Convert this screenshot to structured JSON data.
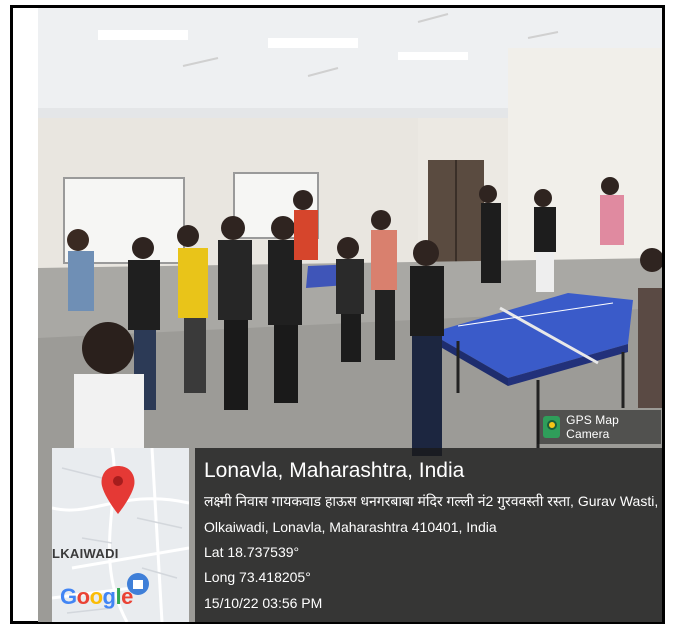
{
  "stamp": {
    "app_label": "GPS Map Camera",
    "app_icon": "gps-map-camera-icon"
  },
  "map": {
    "area_label": "LKAIWADI",
    "brand": [
      "G",
      "o",
      "o",
      "g",
      "l",
      "e"
    ],
    "pin_color": "#e53935"
  },
  "location": {
    "title": "Lonavla, Maharashtra, India",
    "address_line1": "लक्ष्मी निवास गायकवाड हाऊस धनगरबाबा मंदिर गल्ली नं2 गुरववस्ती रस्ता, Gurav Wasti,",
    "address_line2": "Olkaiwadi, Lonavla, Maharashtra 410401, India",
    "latitude": "Lat 18.737539°",
    "longitude": "Long 73.418205°",
    "datetime": "15/10/22 03:56 PM"
  }
}
